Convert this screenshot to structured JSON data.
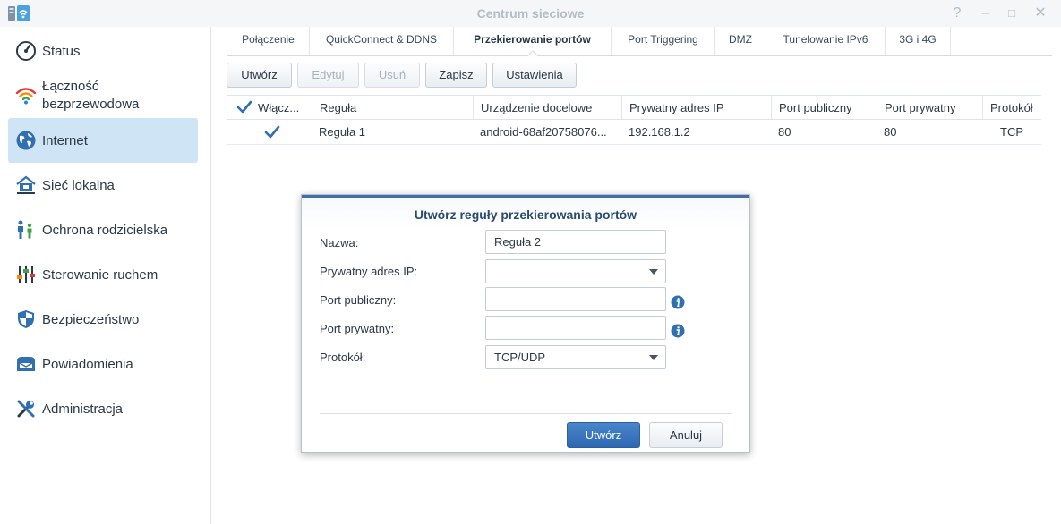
{
  "window": {
    "title": "Centrum sieciowe",
    "help_glyph": "?",
    "minimize_glyph": "–",
    "maximize_glyph": "□",
    "close_glyph": "✕"
  },
  "sidebar": {
    "items": [
      {
        "label": "Status",
        "icon": "gauge-icon",
        "active": false
      },
      {
        "label": "Łączność bezprzewodowa",
        "icon": "wifi-icon",
        "active": false
      },
      {
        "label": "Internet",
        "icon": "globe-icon",
        "active": true
      },
      {
        "label": "Sieć lokalna",
        "icon": "home-network-icon",
        "active": false
      },
      {
        "label": "Ochrona rodzicielska",
        "icon": "family-icon",
        "active": false
      },
      {
        "label": "Sterowanie ruchem",
        "icon": "sliders-icon",
        "active": false
      },
      {
        "label": "Bezpieczeństwo",
        "icon": "shield-icon",
        "active": false
      },
      {
        "label": "Powiadomienia",
        "icon": "mailbox-icon",
        "active": false
      },
      {
        "label": "Administracja",
        "icon": "tools-icon",
        "active": false
      }
    ]
  },
  "tabs": [
    {
      "label": "Połączenie",
      "active": false
    },
    {
      "label": "QuickConnect & DDNS",
      "active": false
    },
    {
      "label": "Przekierowanie portów",
      "active": true
    },
    {
      "label": "Port Triggering",
      "active": false
    },
    {
      "label": "DMZ",
      "active": false
    },
    {
      "label": "Tunelowanie IPv6",
      "active": false
    },
    {
      "label": "3G i 4G",
      "active": false
    }
  ],
  "toolbar": {
    "create": "Utwórz",
    "edit": "Edytuj",
    "delete": "Usuń",
    "save": "Zapisz",
    "settings": "Ustawienia"
  },
  "table": {
    "columns": [
      "Włącz...",
      "Reguła",
      "Urządzenie docelowe",
      "Prywatny adres IP",
      "Port publiczny",
      "Port prywatny",
      "Protokół"
    ],
    "rows": [
      {
        "enabled": true,
        "rule": "Reguła 1",
        "device": "android-68af20758076...",
        "ip": "192.168.1.2",
        "public_port": "80",
        "private_port": "80",
        "protocol": "TCP"
      }
    ]
  },
  "dialog": {
    "title": "Utwórz reguły przekierowania portów",
    "fields": {
      "name_label": "Nazwa:",
      "name_value": "Reguła 2",
      "ip_label": "Prywatny adres IP:",
      "ip_value": "",
      "public_port_label": "Port publiczny:",
      "public_port_value": "",
      "private_port_label": "Port prywatny:",
      "private_port_value": "",
      "protocol_label": "Protokół:",
      "protocol_value": "TCP/UDP"
    },
    "create_button": "Utwórz",
    "cancel_button": "Anuluj"
  },
  "colors": {
    "accent": "#3f6ea8",
    "active_nav": "#cfe4f5",
    "check": "#2f6fb2",
    "info": "#2f6fb2"
  }
}
